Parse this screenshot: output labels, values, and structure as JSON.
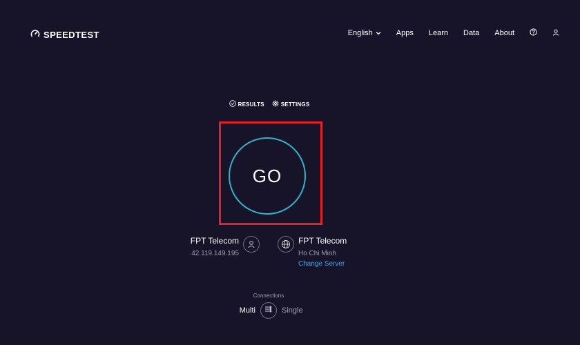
{
  "header": {
    "logo_text": "SPEEDTEST",
    "nav": [
      {
        "label": "English"
      },
      {
        "label": "Apps"
      },
      {
        "label": "Learn"
      },
      {
        "label": "Data"
      },
      {
        "label": "About"
      }
    ]
  },
  "tabs": {
    "results_label": "RESULTS",
    "settings_label": "SETTINGS"
  },
  "go": {
    "label": "GO"
  },
  "provider": {
    "name": "FPT Telecom",
    "ip": "42.119.149.195"
  },
  "server": {
    "name": "FPT Telecom",
    "location": "Ho Chi Minh",
    "change_label": "Change Server"
  },
  "connections": {
    "label": "Connections",
    "multi_label": "Multi",
    "single_label": "Single"
  },
  "colors": {
    "background": "#171429",
    "go_ring": "#2eb4c8",
    "highlight": "#e32226",
    "link": "#3ea6e3",
    "muted_text": "#9e9cb0"
  }
}
